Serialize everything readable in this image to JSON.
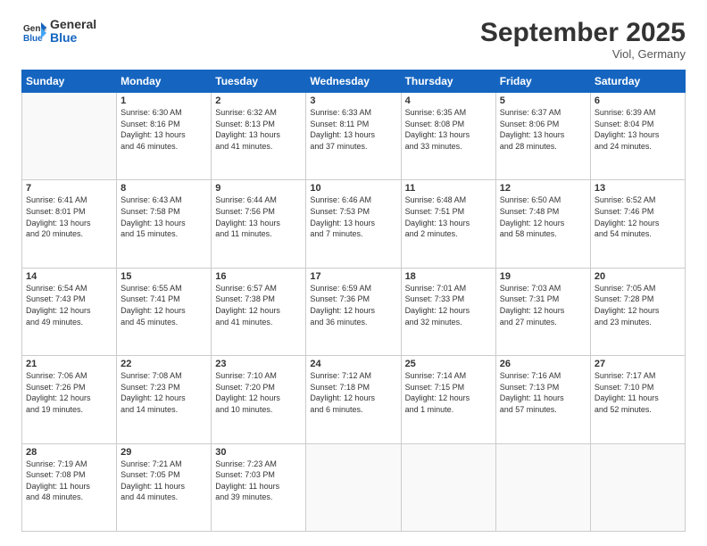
{
  "header": {
    "logo_general": "General",
    "logo_blue": "Blue",
    "month_title": "September 2025",
    "location": "Viol, Germany"
  },
  "weekdays": [
    "Sunday",
    "Monday",
    "Tuesday",
    "Wednesday",
    "Thursday",
    "Friday",
    "Saturday"
  ],
  "weeks": [
    [
      {
        "day": "",
        "info": ""
      },
      {
        "day": "1",
        "info": "Sunrise: 6:30 AM\nSunset: 8:16 PM\nDaylight: 13 hours\nand 46 minutes."
      },
      {
        "day": "2",
        "info": "Sunrise: 6:32 AM\nSunset: 8:13 PM\nDaylight: 13 hours\nand 41 minutes."
      },
      {
        "day": "3",
        "info": "Sunrise: 6:33 AM\nSunset: 8:11 PM\nDaylight: 13 hours\nand 37 minutes."
      },
      {
        "day": "4",
        "info": "Sunrise: 6:35 AM\nSunset: 8:08 PM\nDaylight: 13 hours\nand 33 minutes."
      },
      {
        "day": "5",
        "info": "Sunrise: 6:37 AM\nSunset: 8:06 PM\nDaylight: 13 hours\nand 28 minutes."
      },
      {
        "day": "6",
        "info": "Sunrise: 6:39 AM\nSunset: 8:04 PM\nDaylight: 13 hours\nand 24 minutes."
      }
    ],
    [
      {
        "day": "7",
        "info": "Sunrise: 6:41 AM\nSunset: 8:01 PM\nDaylight: 13 hours\nand 20 minutes."
      },
      {
        "day": "8",
        "info": "Sunrise: 6:43 AM\nSunset: 7:58 PM\nDaylight: 13 hours\nand 15 minutes."
      },
      {
        "day": "9",
        "info": "Sunrise: 6:44 AM\nSunset: 7:56 PM\nDaylight: 13 hours\nand 11 minutes."
      },
      {
        "day": "10",
        "info": "Sunrise: 6:46 AM\nSunset: 7:53 PM\nDaylight: 13 hours\nand 7 minutes."
      },
      {
        "day": "11",
        "info": "Sunrise: 6:48 AM\nSunset: 7:51 PM\nDaylight: 13 hours\nand 2 minutes."
      },
      {
        "day": "12",
        "info": "Sunrise: 6:50 AM\nSunset: 7:48 PM\nDaylight: 12 hours\nand 58 minutes."
      },
      {
        "day": "13",
        "info": "Sunrise: 6:52 AM\nSunset: 7:46 PM\nDaylight: 12 hours\nand 54 minutes."
      }
    ],
    [
      {
        "day": "14",
        "info": "Sunrise: 6:54 AM\nSunset: 7:43 PM\nDaylight: 12 hours\nand 49 minutes."
      },
      {
        "day": "15",
        "info": "Sunrise: 6:55 AM\nSunset: 7:41 PM\nDaylight: 12 hours\nand 45 minutes."
      },
      {
        "day": "16",
        "info": "Sunrise: 6:57 AM\nSunset: 7:38 PM\nDaylight: 12 hours\nand 41 minutes."
      },
      {
        "day": "17",
        "info": "Sunrise: 6:59 AM\nSunset: 7:36 PM\nDaylight: 12 hours\nand 36 minutes."
      },
      {
        "day": "18",
        "info": "Sunrise: 7:01 AM\nSunset: 7:33 PM\nDaylight: 12 hours\nand 32 minutes."
      },
      {
        "day": "19",
        "info": "Sunrise: 7:03 AM\nSunset: 7:31 PM\nDaylight: 12 hours\nand 27 minutes."
      },
      {
        "day": "20",
        "info": "Sunrise: 7:05 AM\nSunset: 7:28 PM\nDaylight: 12 hours\nand 23 minutes."
      }
    ],
    [
      {
        "day": "21",
        "info": "Sunrise: 7:06 AM\nSunset: 7:26 PM\nDaylight: 12 hours\nand 19 minutes."
      },
      {
        "day": "22",
        "info": "Sunrise: 7:08 AM\nSunset: 7:23 PM\nDaylight: 12 hours\nand 14 minutes."
      },
      {
        "day": "23",
        "info": "Sunrise: 7:10 AM\nSunset: 7:20 PM\nDaylight: 12 hours\nand 10 minutes."
      },
      {
        "day": "24",
        "info": "Sunrise: 7:12 AM\nSunset: 7:18 PM\nDaylight: 12 hours\nand 6 minutes."
      },
      {
        "day": "25",
        "info": "Sunrise: 7:14 AM\nSunset: 7:15 PM\nDaylight: 12 hours\nand 1 minute."
      },
      {
        "day": "26",
        "info": "Sunrise: 7:16 AM\nSunset: 7:13 PM\nDaylight: 11 hours\nand 57 minutes."
      },
      {
        "day": "27",
        "info": "Sunrise: 7:17 AM\nSunset: 7:10 PM\nDaylight: 11 hours\nand 52 minutes."
      }
    ],
    [
      {
        "day": "28",
        "info": "Sunrise: 7:19 AM\nSunset: 7:08 PM\nDaylight: 11 hours\nand 48 minutes."
      },
      {
        "day": "29",
        "info": "Sunrise: 7:21 AM\nSunset: 7:05 PM\nDaylight: 11 hours\nand 44 minutes."
      },
      {
        "day": "30",
        "info": "Sunrise: 7:23 AM\nSunset: 7:03 PM\nDaylight: 11 hours\nand 39 minutes."
      },
      {
        "day": "",
        "info": ""
      },
      {
        "day": "",
        "info": ""
      },
      {
        "day": "",
        "info": ""
      },
      {
        "day": "",
        "info": ""
      }
    ]
  ]
}
